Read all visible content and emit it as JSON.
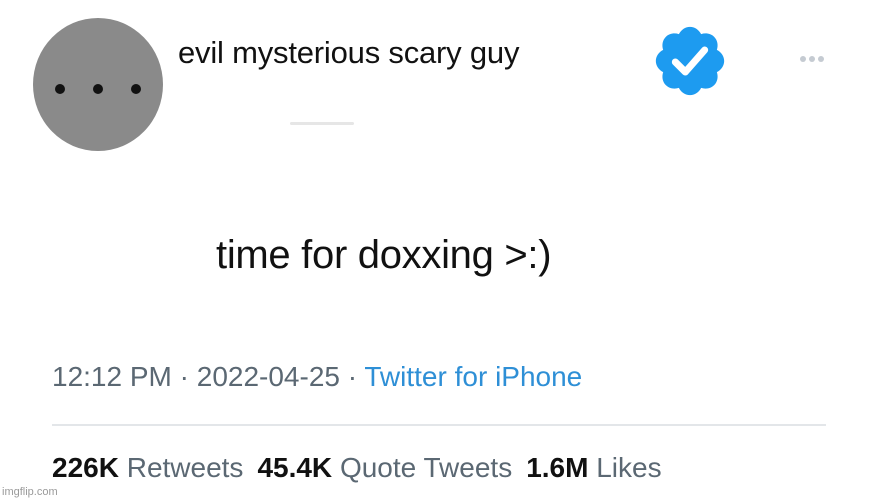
{
  "tweet": {
    "display_name": "evil mysterious scary guy",
    "text": "time for doxxing >:)",
    "time": "12:12 PM",
    "date": "2022-04-25",
    "separator": "·",
    "source": "Twitter for iPhone",
    "verified_color": "#1d9bf0"
  },
  "stats": {
    "retweets_count": "226K",
    "retweets_label": "Retweets",
    "quotes_count": "45.4K",
    "quotes_label": "Quote Tweets",
    "likes_count": "1.6M",
    "likes_label": "Likes"
  },
  "avatar": {
    "placeholder": "• • •"
  },
  "watermark": "imgflip.com"
}
